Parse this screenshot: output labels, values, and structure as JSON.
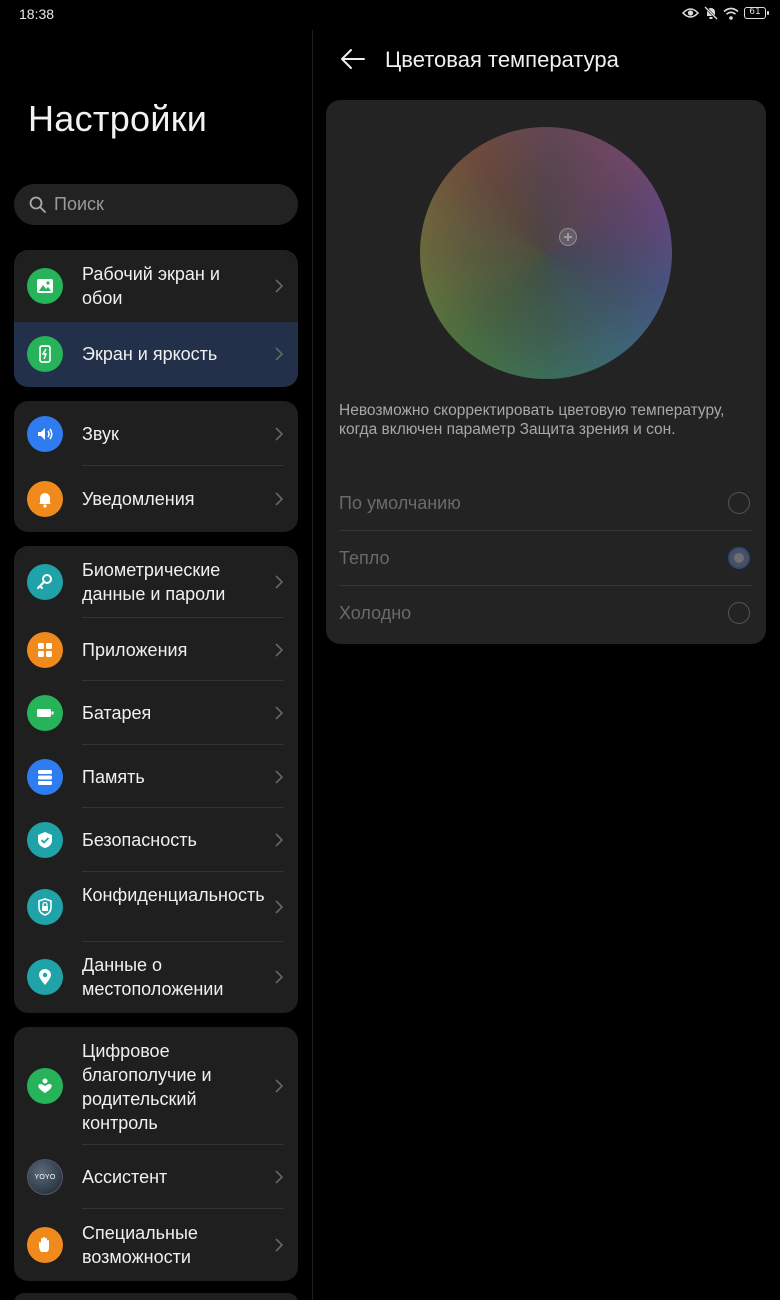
{
  "status_bar": {
    "time": "18:38",
    "battery": "61"
  },
  "left": {
    "title": "Настройки",
    "search_placeholder": "Поиск",
    "groups": [
      {
        "items": [
          {
            "label": "Рабочий экран и обои",
            "icon": "wallpaper-icon",
            "color": "#26b35a"
          },
          {
            "label": "Экран и яркость",
            "icon": "display-brightness-icon",
            "color": "#26b35a",
            "active": true
          }
        ]
      },
      {
        "items": [
          {
            "label": "Звук",
            "icon": "sound-icon",
            "color": "#2f7cf0"
          },
          {
            "label": "Уведомления",
            "icon": "bell-icon",
            "color": "#f08a1c"
          }
        ]
      },
      {
        "items": [
          {
            "label": "Биометрические данные и пароли",
            "icon": "key-icon",
            "color": "#1fa3a8"
          },
          {
            "label": "Приложения",
            "icon": "apps-icon",
            "color": "#f08a1c"
          },
          {
            "label": "Батарея",
            "icon": "battery-icon",
            "color": "#26b35a"
          },
          {
            "label": "Память",
            "icon": "storage-icon",
            "color": "#2f7cf0"
          },
          {
            "label": "Безопасность",
            "icon": "shield-icon",
            "color": "#1fa3a8"
          },
          {
            "label": "Конфиденциальность",
            "icon": "privacy-lock-icon",
            "color": "#1fa3a8"
          },
          {
            "label": "Данные о местоположении",
            "icon": "location-icon",
            "color": "#1fa3a8"
          }
        ]
      },
      {
        "items": [
          {
            "label": "Цифровое благополучие и родительский контроль",
            "icon": "wellbeing-icon",
            "color": "#26b35a"
          },
          {
            "label": "Ассистент",
            "icon": "assistant-yoyo-icon",
            "icon_text": "YOYO",
            "color": "#2a3a4a"
          },
          {
            "label": "Специальные возможности",
            "icon": "hand-icon",
            "color": "#f08a1c"
          }
        ]
      }
    ]
  },
  "right": {
    "title": "Цветовая температура",
    "note": "Невозможно скорректировать цветовую температуру, когда включен параметр Защита зрения и сон.",
    "options": [
      {
        "label": "По умолчанию",
        "checked": false
      },
      {
        "label": "Тепло",
        "checked": true
      },
      {
        "label": "Холодно",
        "checked": false
      }
    ]
  }
}
